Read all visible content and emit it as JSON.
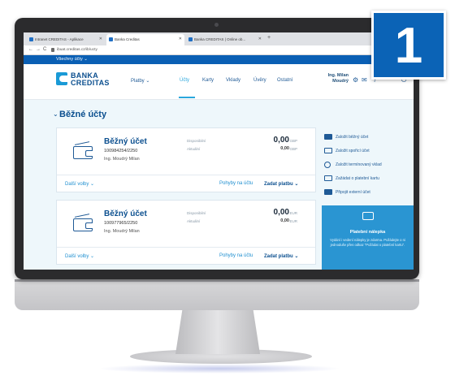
{
  "badge": {
    "number": "1"
  },
  "browser": {
    "tabs": [
      {
        "label": "Intranet CREDITAS - Aplikace"
      },
      {
        "label": "Banka Creditas"
      },
      {
        "label": "Banka CREDITAS | Online ob..."
      }
    ],
    "new_tab": "+",
    "url": "ibuat.creditas.cz/ib/ucty"
  },
  "site": {
    "accounts_dropdown": "Všechny účty ⌄",
    "logo_line1": "BANKA",
    "logo_line2": "CREDITAS",
    "nav": {
      "payments": "Platby ⌄",
      "accounts": "Účty",
      "cards": "Karty",
      "deposits": "Vklady",
      "loans": "Úvěry",
      "other": "Ostatní"
    },
    "user_line1": "Ing. Milan",
    "user_line2": "Moudrý"
  },
  "section": {
    "title": "Běžné účty"
  },
  "accounts": [
    {
      "name": "Běžný účet",
      "number": "100984254/2250",
      "owner": "Ing. Moudrý Milan",
      "label_available": "Disponibilní",
      "label_current": "Aktuální",
      "balance_available": "0,00",
      "balance_current": "0,00",
      "currency": "GBP",
      "more": "Další volby ⌄",
      "movements": "Pohyby na účtu",
      "pay": "Zadat platbu ⌄"
    },
    {
      "name": "Běžný účet",
      "number": "100977965/2250",
      "owner": "Ing. Moudrý Milan",
      "label_available": "Disponibilní",
      "label_current": "Aktuální",
      "balance_available": "0,00",
      "balance_current": "0,00",
      "currency": "EUR",
      "more": "Další volby ⌄",
      "movements": "Pohyby na účtu",
      "pay": "Zadat platbu ⌄"
    }
  ],
  "actions": [
    {
      "label": "Založit běžný účet",
      "icon": "tip-icon"
    },
    {
      "label": "Založit spořicí účet",
      "icon": "savings-icon"
    },
    {
      "label": "Založit termínovaný vklad",
      "icon": "clock-icon"
    },
    {
      "label": "Zažádat o platební kartu",
      "icon": "card-icon"
    },
    {
      "label": "Připojit externí účet",
      "icon": "tip-icon"
    }
  ],
  "promo": {
    "title": "Platební nálepka",
    "text": "Vydání i vedení nálepky je zdarma. Požádejte o ni jednoduše přes odkaz \"Požádat o platební kartu\"."
  }
}
